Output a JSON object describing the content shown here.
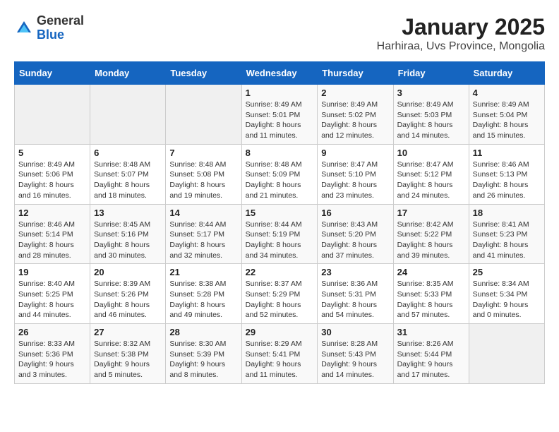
{
  "header": {
    "logo_general": "General",
    "logo_blue": "Blue",
    "title": "January 2025",
    "subtitle": "Harhiraa, Uvs Province, Mongolia"
  },
  "weekdays": [
    "Sunday",
    "Monday",
    "Tuesday",
    "Wednesday",
    "Thursday",
    "Friday",
    "Saturday"
  ],
  "weeks": [
    [
      {
        "day": "",
        "info": ""
      },
      {
        "day": "",
        "info": ""
      },
      {
        "day": "",
        "info": ""
      },
      {
        "day": "1",
        "info": "Sunrise: 8:49 AM\nSunset: 5:01 PM\nDaylight: 8 hours\nand 11 minutes."
      },
      {
        "day": "2",
        "info": "Sunrise: 8:49 AM\nSunset: 5:02 PM\nDaylight: 8 hours\nand 12 minutes."
      },
      {
        "day": "3",
        "info": "Sunrise: 8:49 AM\nSunset: 5:03 PM\nDaylight: 8 hours\nand 14 minutes."
      },
      {
        "day": "4",
        "info": "Sunrise: 8:49 AM\nSunset: 5:04 PM\nDaylight: 8 hours\nand 15 minutes."
      }
    ],
    [
      {
        "day": "5",
        "info": "Sunrise: 8:49 AM\nSunset: 5:06 PM\nDaylight: 8 hours\nand 16 minutes."
      },
      {
        "day": "6",
        "info": "Sunrise: 8:48 AM\nSunset: 5:07 PM\nDaylight: 8 hours\nand 18 minutes."
      },
      {
        "day": "7",
        "info": "Sunrise: 8:48 AM\nSunset: 5:08 PM\nDaylight: 8 hours\nand 19 minutes."
      },
      {
        "day": "8",
        "info": "Sunrise: 8:48 AM\nSunset: 5:09 PM\nDaylight: 8 hours\nand 21 minutes."
      },
      {
        "day": "9",
        "info": "Sunrise: 8:47 AM\nSunset: 5:10 PM\nDaylight: 8 hours\nand 23 minutes."
      },
      {
        "day": "10",
        "info": "Sunrise: 8:47 AM\nSunset: 5:12 PM\nDaylight: 8 hours\nand 24 minutes."
      },
      {
        "day": "11",
        "info": "Sunrise: 8:46 AM\nSunset: 5:13 PM\nDaylight: 8 hours\nand 26 minutes."
      }
    ],
    [
      {
        "day": "12",
        "info": "Sunrise: 8:46 AM\nSunset: 5:14 PM\nDaylight: 8 hours\nand 28 minutes."
      },
      {
        "day": "13",
        "info": "Sunrise: 8:45 AM\nSunset: 5:16 PM\nDaylight: 8 hours\nand 30 minutes."
      },
      {
        "day": "14",
        "info": "Sunrise: 8:44 AM\nSunset: 5:17 PM\nDaylight: 8 hours\nand 32 minutes."
      },
      {
        "day": "15",
        "info": "Sunrise: 8:44 AM\nSunset: 5:19 PM\nDaylight: 8 hours\nand 34 minutes."
      },
      {
        "day": "16",
        "info": "Sunrise: 8:43 AM\nSunset: 5:20 PM\nDaylight: 8 hours\nand 37 minutes."
      },
      {
        "day": "17",
        "info": "Sunrise: 8:42 AM\nSunset: 5:22 PM\nDaylight: 8 hours\nand 39 minutes."
      },
      {
        "day": "18",
        "info": "Sunrise: 8:41 AM\nSunset: 5:23 PM\nDaylight: 8 hours\nand 41 minutes."
      }
    ],
    [
      {
        "day": "19",
        "info": "Sunrise: 8:40 AM\nSunset: 5:25 PM\nDaylight: 8 hours\nand 44 minutes."
      },
      {
        "day": "20",
        "info": "Sunrise: 8:39 AM\nSunset: 5:26 PM\nDaylight: 8 hours\nand 46 minutes."
      },
      {
        "day": "21",
        "info": "Sunrise: 8:38 AM\nSunset: 5:28 PM\nDaylight: 8 hours\nand 49 minutes."
      },
      {
        "day": "22",
        "info": "Sunrise: 8:37 AM\nSunset: 5:29 PM\nDaylight: 8 hours\nand 52 minutes."
      },
      {
        "day": "23",
        "info": "Sunrise: 8:36 AM\nSunset: 5:31 PM\nDaylight: 8 hours\nand 54 minutes."
      },
      {
        "day": "24",
        "info": "Sunrise: 8:35 AM\nSunset: 5:33 PM\nDaylight: 8 hours\nand 57 minutes."
      },
      {
        "day": "25",
        "info": "Sunrise: 8:34 AM\nSunset: 5:34 PM\nDaylight: 9 hours\nand 0 minutes."
      }
    ],
    [
      {
        "day": "26",
        "info": "Sunrise: 8:33 AM\nSunset: 5:36 PM\nDaylight: 9 hours\nand 3 minutes."
      },
      {
        "day": "27",
        "info": "Sunrise: 8:32 AM\nSunset: 5:38 PM\nDaylight: 9 hours\nand 5 minutes."
      },
      {
        "day": "28",
        "info": "Sunrise: 8:30 AM\nSunset: 5:39 PM\nDaylight: 9 hours\nand 8 minutes."
      },
      {
        "day": "29",
        "info": "Sunrise: 8:29 AM\nSunset: 5:41 PM\nDaylight: 9 hours\nand 11 minutes."
      },
      {
        "day": "30",
        "info": "Sunrise: 8:28 AM\nSunset: 5:43 PM\nDaylight: 9 hours\nand 14 minutes."
      },
      {
        "day": "31",
        "info": "Sunrise: 8:26 AM\nSunset: 5:44 PM\nDaylight: 9 hours\nand 17 minutes."
      },
      {
        "day": "",
        "info": ""
      }
    ]
  ]
}
